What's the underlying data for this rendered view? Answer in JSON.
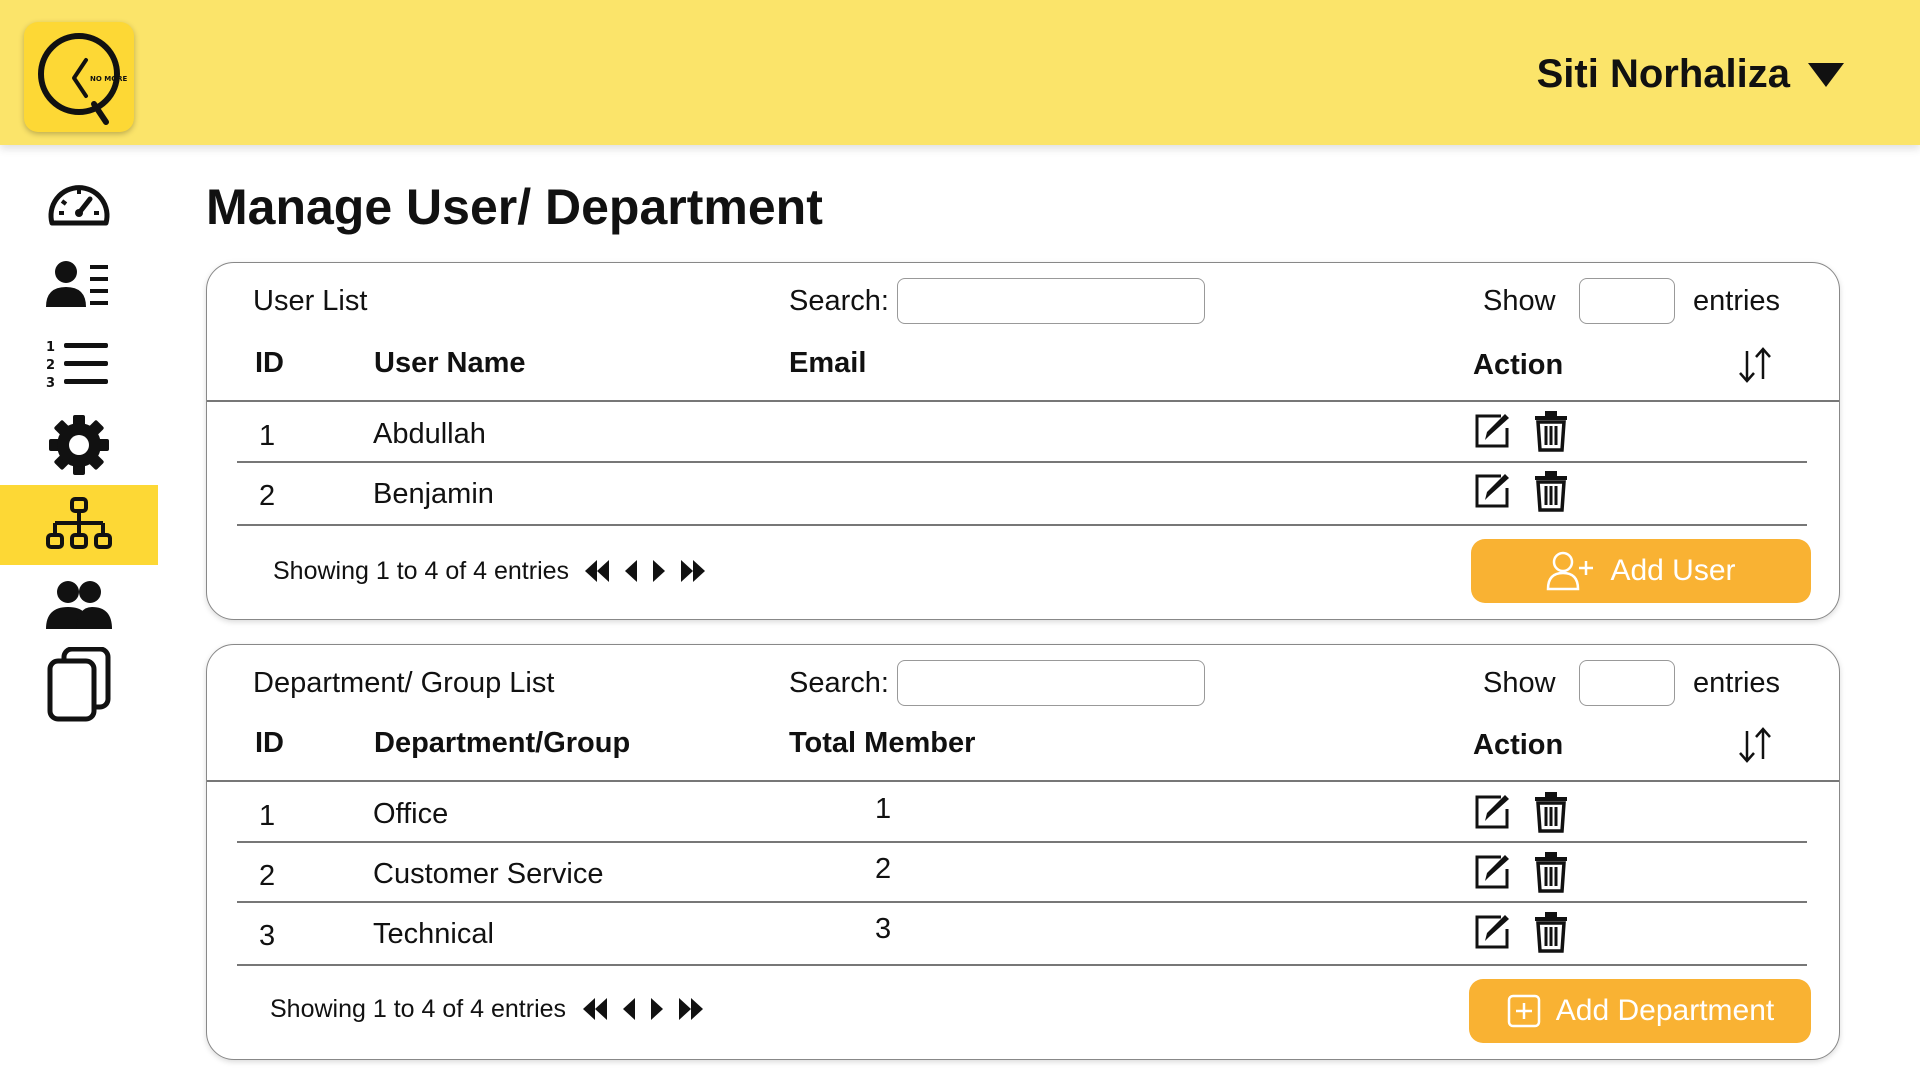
{
  "header": {
    "user_name": "Siti Norhaliza",
    "logo_text": "NO MORE",
    "brand_color": "#fbe46a",
    "accent_color": "#fdd835"
  },
  "sidebar": {
    "items": [
      {
        "icon": "dashboard-gauge-icon",
        "active": false
      },
      {
        "icon": "user-profile-list-icon",
        "active": false
      },
      {
        "icon": "numbered-list-icon",
        "active": false
      },
      {
        "icon": "gear-icon",
        "active": false
      },
      {
        "icon": "org-chart-icon",
        "active": true
      },
      {
        "icon": "users-group-icon",
        "active": false
      },
      {
        "icon": "copy-pages-icon",
        "active": false
      }
    ]
  },
  "page": {
    "title": "Manage User/ Department"
  },
  "users_panel": {
    "title": "User List",
    "search_label": "Search:",
    "search_value": "",
    "show_label": "Show",
    "entries_label": "entries",
    "show_value": "",
    "columns": [
      "ID",
      "User Name",
      "Email",
      "Action"
    ],
    "rows": [
      {
        "id": "1",
        "name": "Abdullah",
        "email": ""
      },
      {
        "id": "2",
        "name": "Benjamin",
        "email": ""
      }
    ],
    "pager_text": "Showing 1 to 4 of 4 entries",
    "add_button": "Add User"
  },
  "depts_panel": {
    "title": "Department/ Group List",
    "search_label": "Search:",
    "search_value": "",
    "show_label": "Show",
    "entries_label": "entries",
    "show_value": "",
    "columns": [
      "ID",
      "Department/Group",
      "Total Member",
      "Action"
    ],
    "rows": [
      {
        "id": "1",
        "name": "Office",
        "members": "1"
      },
      {
        "id": "2",
        "name": "Customer Service",
        "members": "2"
      },
      {
        "id": "3",
        "name": "Technical",
        "members": "3"
      }
    ],
    "pager_text": "Showing 1 to 4 of 4 entries",
    "add_button": "Add Department"
  },
  "colors": {
    "button_orange": "#f9b233",
    "active_nav": "#fdd835"
  }
}
